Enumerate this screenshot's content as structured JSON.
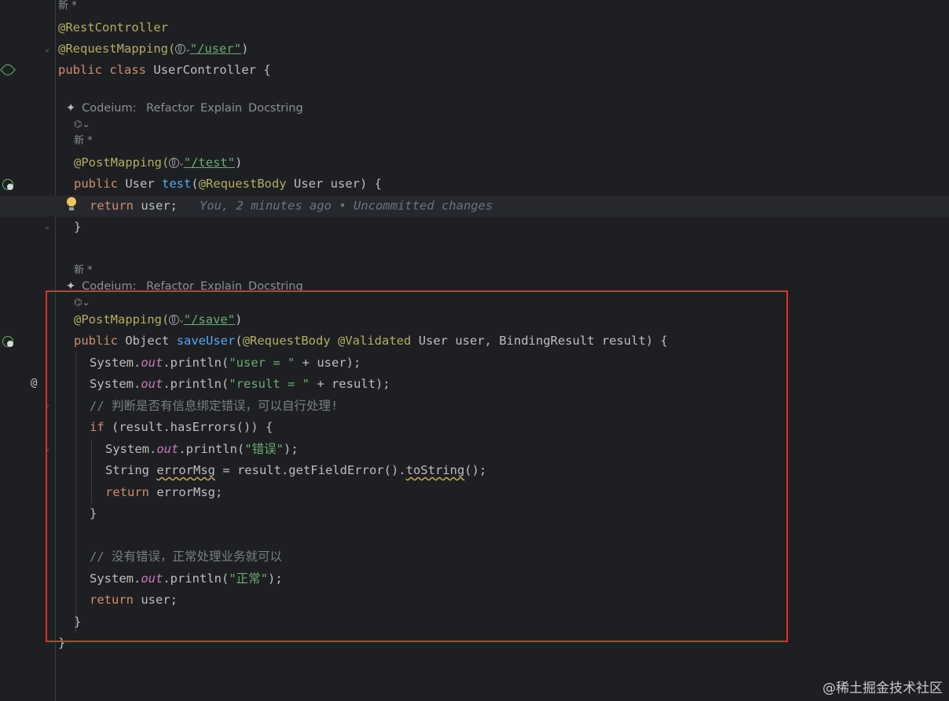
{
  "editor": {
    "author_marker": "新 *",
    "codeium_lens": {
      "prefix": "Codeium:",
      "refactor": "Refactor",
      "explain": "Explain",
      "docstring": "Docstring"
    },
    "blame_hint": "You, 2 minutes ago • Uncommitted changes",
    "lines": {
      "l_restcontroller": "@RestController",
      "l_requestmapping_prefix": "@RequestMapping(",
      "l_requestmapping_path": "\"/user\"",
      "l_requestmapping_close": ")",
      "l_class_public": "public",
      "l_class_class": "class",
      "l_class_name": "UserController {",
      "l_post1_ann": "@PostMapping(",
      "l_post1_path": "\"/test\"",
      "l_post1_close": ")",
      "l_test_public": "public",
      "l_test_type": "User",
      "l_test_name": "test",
      "l_test_open": "(",
      "l_test_ann": "@RequestBody",
      "l_test_params": "User user) {",
      "l_return_kw": "return",
      "l_return_val": "user;",
      "l_close1": "}",
      "l_post2_ann": "@PostMapping(",
      "l_post2_path": "\"/save\"",
      "l_post2_close": ")",
      "l_save_public": "public",
      "l_save_type": "Object",
      "l_save_name": "saveUser",
      "l_save_open": "(",
      "l_save_ann1": "@RequestBody",
      "l_save_ann2": "@Validated",
      "l_save_params": "User user, BindingResult result) {",
      "l_p1_sys": "System.",
      "l_p1_out": "out",
      "l_p1_call": ".println(",
      "l_p1_str": "\"user = \"",
      "l_p1_rest": " + user);",
      "l_p2_sys": "System.",
      "l_p2_out": "out",
      "l_p2_call": ".println(",
      "l_p2_str": "\"result = \"",
      "l_p2_rest": " + result);",
      "l_comment1": "// 判断是否有信息绑定错误，可以自行处理!",
      "l_if_kw": "if",
      "l_if_cond": " (result.hasErrors()) {",
      "l_p3_sys": "System.",
      "l_p3_out": "out",
      "l_p3_call": ".println(",
      "l_p3_str": "\"错误\"",
      "l_p3_rest": ");",
      "l_str_type": "String ",
      "l_str_var": "errorMsg",
      "l_str_mid": " = result.getFieldError().",
      "l_str_tostring": "toString",
      "l_str_end": "();",
      "l_ret2_kw": "return",
      "l_ret2_val": " errorMsg;",
      "l_close_if": "}",
      "l_comment2": "// 没有错误，正常处理业务就可以",
      "l_p4_sys": "System.",
      "l_p4_out": "out",
      "l_p4_call": ".println(",
      "l_p4_str": "\"正常\"",
      "l_p4_rest": ");",
      "l_ret3_kw": "return",
      "l_ret3_val": " user;",
      "l_close_method": "}",
      "l_close_class": "}"
    },
    "gutter": {
      "at_symbol": "@"
    }
  },
  "watermark": "@稀土掘金技术社区"
}
